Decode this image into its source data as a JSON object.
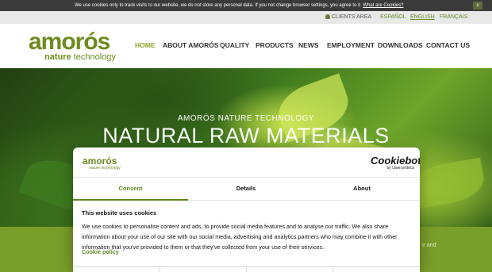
{
  "cookie_notice": {
    "message": "We use cookies only to track visits to our website, we do not store any personal data. If you not change browser settings, you agree to it.",
    "link": "What are Cookies?",
    "close": "x"
  },
  "utility": {
    "clients_area": "CLIENTS AREA",
    "languages": [
      "ESPAÑOL",
      "ENGLISH",
      "FRANÇAIS"
    ],
    "active_language": "ENGLISH"
  },
  "logo": {
    "brand": "amorós",
    "tag_1": "nature",
    "tag_2": "technology"
  },
  "nav": [
    "HOME",
    "ABOUT AMORÓS",
    "QUALITY",
    "PRODUCTS",
    "NEWS",
    "EMPLOYMENT",
    "DOWNLOADS",
    "CONTACT US"
  ],
  "hero": {
    "eyebrow": "AMORÓS NATURE TECHNOLOGY",
    "title": "NATURAL RAW MATERIALS"
  },
  "band": {
    "side_text": "e and"
  },
  "cookie_dialog": {
    "logo_brand": "amorós",
    "logo_tag": "nature technology",
    "provider_name": "Cookiebot",
    "provider_sub": "by Usercentrics",
    "tabs": [
      "Consent",
      "Details",
      "About"
    ],
    "active_tab": "Consent",
    "heading": "This website uses cookies",
    "text": "We use cookies to personalise content and ads, to provide social media features and to analyse our traffic. We also share information about your use of our site with our social media, advertising and analytics partners who may combine it with other information that you've provided to them or that they've collected from your use of their services.",
    "policy_link": "Cookie policy"
  },
  "colors": {
    "brand_green": "#6e8a1e",
    "accent_green": "#5d8a1c",
    "band_green": "#7a9e2a"
  }
}
